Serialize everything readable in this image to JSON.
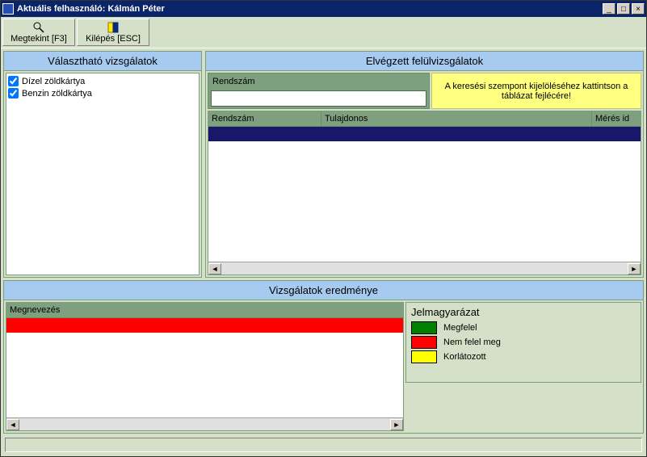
{
  "window": {
    "title": "Aktuális felhasználó: Kálmán Péter"
  },
  "toolbar": {
    "view_label": "Megtekint [F3]",
    "exit_label": "Kilépés [ESC]"
  },
  "left_panel": {
    "title": "Választható vizsgálatok",
    "items": [
      {
        "label": "Dízel zöldkártya",
        "checked": true
      },
      {
        "label": "Benzin zöldkártya",
        "checked": true
      }
    ]
  },
  "right_panel": {
    "title": "Elvégzett felülvizsgálatok",
    "search_label": "Rendszám",
    "search_value": "",
    "hint": "A keresési szempont kijelöléséhez kattintson a táblázat fejlécére!",
    "columns": {
      "c0": "Rendszám",
      "c1": "Tulajdonos",
      "c2": "Mérés id"
    }
  },
  "results": {
    "title": "Vizsgálatok eredménye",
    "column": "Megnevezés",
    "legend_title": "Jelmagyarázat",
    "legend": {
      "ok": "Megfelel",
      "fail": "Nem felel meg",
      "limited": "Korlátozott"
    }
  }
}
